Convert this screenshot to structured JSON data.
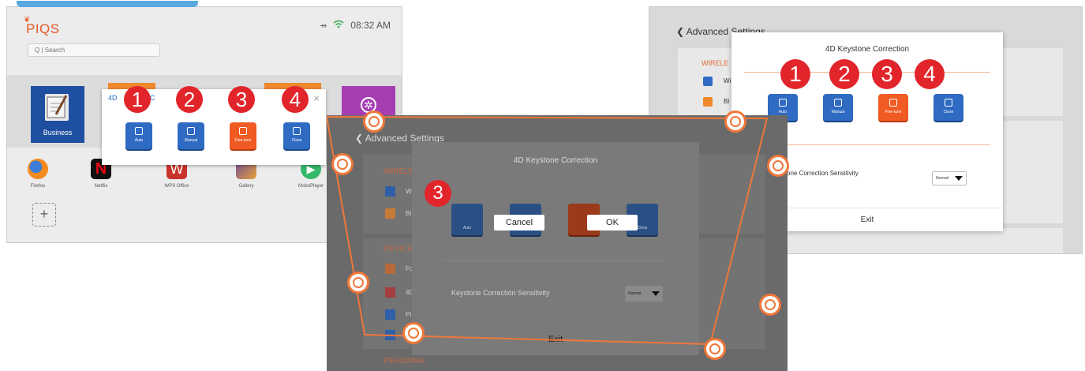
{
  "home": {
    "brand": "PIQS",
    "time": "08:32 AM",
    "search_placeholder": "Q | Search",
    "business_tile": "Business",
    "popup_title": "4D Keystone Correction",
    "popup_title_visible": "4D",
    "popup_title_tail": "e C",
    "close_glyph": "×",
    "buttons": [
      "Auto",
      "Manual",
      "Fine-tune",
      "Close"
    ],
    "dock_apps": [
      "Firefox",
      "Netflix",
      "WPS Office",
      "Gallery",
      "MoboPlayer"
    ],
    "add_glyph": "+"
  },
  "steps": [
    "1",
    "2",
    "3",
    "4"
  ],
  "advanced": {
    "header": "Advanced Settings",
    "sections": [
      "WIRELE",
      "DEVICE",
      "PERSONAL"
    ],
    "item_stubs": [
      "Wi",
      "Bl",
      "Fo",
      "4D",
      "Pi"
    ],
    "dialog_title": "4D Keystone Correction",
    "buttons": [
      "Auto",
      "Manual",
      "Fine-tune",
      "Close"
    ],
    "sensitivity_label_cut": "one Correction Sensitivity",
    "sensitivity_label": "Keystone Correction Sensitivity",
    "sensitivity_value": "Normal",
    "exit_label": "Exit"
  },
  "tune": {
    "step_badge": "3",
    "cancel_label": "Cancel",
    "ok_label": "OK"
  },
  "colors": {
    "step_badge": "#e2252b",
    "button_blue": "#2f6ac3",
    "button_orange": "#f05a23",
    "handle_orange": "#f0773a",
    "accent_blue": "#59a9e1"
  }
}
